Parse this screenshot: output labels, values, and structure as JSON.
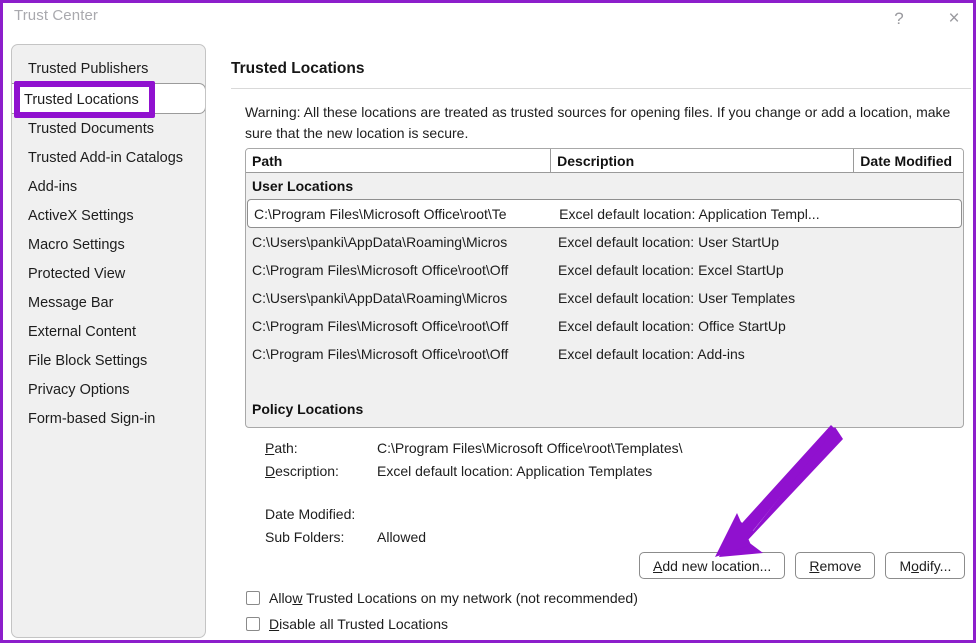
{
  "window": {
    "title": "Trust Center",
    "help_label": "?",
    "close_label": "×",
    "annotation_color": "#9011cf",
    "border_color": "#8c1ecb"
  },
  "sidebar": {
    "items": [
      {
        "label": "Trusted Publishers",
        "selected": false
      },
      {
        "label": "Trusted Locations",
        "selected": true
      },
      {
        "label": "Trusted Documents",
        "selected": false
      },
      {
        "label": "Trusted Add-in Catalogs",
        "selected": false
      },
      {
        "label": "Add-ins",
        "selected": false
      },
      {
        "label": "ActiveX Settings",
        "selected": false
      },
      {
        "label": "Macro Settings",
        "selected": false
      },
      {
        "label": "Protected View",
        "selected": false
      },
      {
        "label": "Message Bar",
        "selected": false
      },
      {
        "label": "External Content",
        "selected": false
      },
      {
        "label": "File Block Settings",
        "selected": false
      },
      {
        "label": "Privacy Options",
        "selected": false
      },
      {
        "label": "Form-based Sign-in",
        "selected": false
      }
    ],
    "highlighted_item": "Trusted Locations"
  },
  "main": {
    "page_title": "Trusted Locations",
    "warning": "Warning: All these locations are treated as trusted sources for opening files.  If you change or add a location, make sure that the new location is secure.",
    "table": {
      "columns": [
        "Path",
        "Description",
        "Date Modified"
      ],
      "groups": [
        {
          "name": "User Locations",
          "rows": [
            {
              "path": "C:\\Program Files\\Microsoft Office\\root\\Te",
              "description": "Excel default location: Application Templ...",
              "date_modified": "",
              "selected": true
            },
            {
              "path": "C:\\Users\\panki\\AppData\\Roaming\\Micros",
              "description": "Excel default location: User StartUp",
              "date_modified": "",
              "selected": false
            },
            {
              "path": "C:\\Program Files\\Microsoft Office\\root\\Off",
              "description": "Excel default location: Excel StartUp",
              "date_modified": "",
              "selected": false
            },
            {
              "path": "C:\\Users\\panki\\AppData\\Roaming\\Micros",
              "description": "Excel default location: User Templates",
              "date_modified": "",
              "selected": false
            },
            {
              "path": "C:\\Program Files\\Microsoft Office\\root\\Off",
              "description": "Excel default location: Office StartUp",
              "date_modified": "",
              "selected": false
            },
            {
              "path": "C:\\Program Files\\Microsoft Office\\root\\Off",
              "description": "Excel default location: Add-ins",
              "date_modified": "",
              "selected": false
            }
          ]
        },
        {
          "name": "Policy Locations",
          "rows": []
        }
      ]
    },
    "details": {
      "path_label": "Path:",
      "path_value": "C:\\Program Files\\Microsoft Office\\root\\Templates\\",
      "description_label": "Description:",
      "description_value": "Excel default location: Application Templates",
      "date_modified_label": "Date Modified:",
      "date_modified_value": "",
      "sub_folders_label": "Sub Folders:",
      "sub_folders_value": "Allowed"
    },
    "buttons": {
      "add": "Add new location...",
      "remove": "Remove",
      "modify": "Modify..."
    },
    "checkboxes": [
      {
        "label": "Allow Trusted Locations on my network (not recommended)",
        "checked": false
      },
      {
        "label": "Disable all Trusted Locations",
        "checked": false
      }
    ]
  }
}
